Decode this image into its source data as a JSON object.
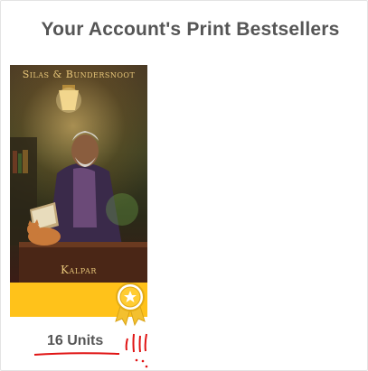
{
  "panel": {
    "title": "Your Account's Print Bestsellers"
  },
  "book": {
    "cover_title": "Silas & Bundersnoot",
    "cover_author": "Kalpar",
    "units": "16 Units"
  },
  "colors": {
    "band": "#ffc21a",
    "title_text": "#555555",
    "annotation": "#e01414"
  },
  "icons": {
    "ribbon": "award-ribbon-icon"
  }
}
